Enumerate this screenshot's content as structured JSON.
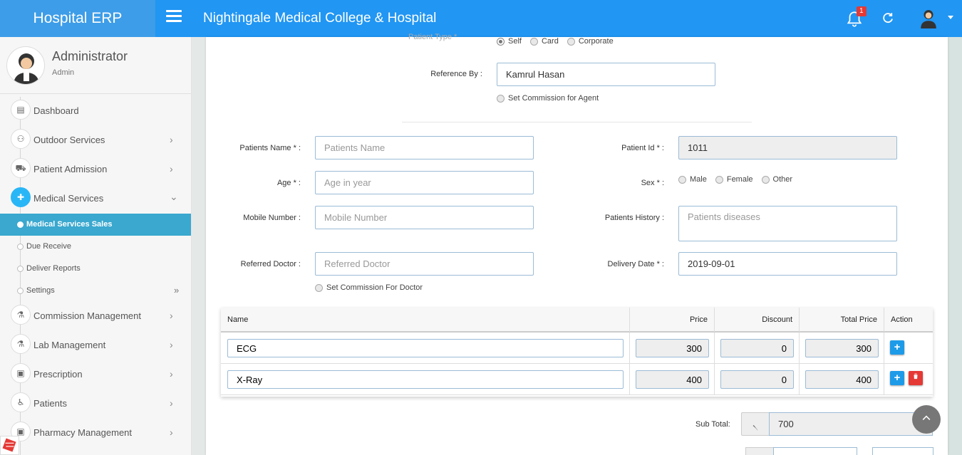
{
  "header": {
    "brand": "Hospital ERP",
    "title": "Nightingale Medical College & Hospital",
    "notification_count": "1",
    "colors": {
      "bar": "#2196f3",
      "brand_bg": "#3d9de8",
      "badge": "#e53935"
    }
  },
  "profile": {
    "name": "Administrator",
    "role": "Admin"
  },
  "sidebar": {
    "items": [
      {
        "label": "Dashboard",
        "icon": "clipboard-icon",
        "chevron": ""
      },
      {
        "label": "Outdoor Services",
        "icon": "user-group-icon",
        "chevron": "›"
      },
      {
        "label": "Patient Admission",
        "icon": "ambulance-icon",
        "chevron": "›"
      },
      {
        "label": "Medical Services",
        "icon": "medical-kit-icon",
        "chevron": "⌄"
      },
      {
        "label": "Commission Management",
        "icon": "flask-icon",
        "chevron": "›"
      },
      {
        "label": "Lab Management",
        "icon": "flask-icon",
        "chevron": "›"
      },
      {
        "label": "Prescription",
        "icon": "save-icon",
        "chevron": "›"
      },
      {
        "label": "Patients",
        "icon": "wheelchair-icon",
        "chevron": "›"
      },
      {
        "label": "Pharmacy Management",
        "icon": "save-icon",
        "chevron": "›"
      }
    ],
    "submenu": [
      {
        "label": "Medical Services Sales",
        "active": true,
        "chevron": ""
      },
      {
        "label": "Due Receive",
        "active": false,
        "chevron": ""
      },
      {
        "label": "Deliver Reports",
        "active": false,
        "chevron": ""
      },
      {
        "label": "Settings",
        "active": false,
        "chevron": "»"
      }
    ]
  },
  "form": {
    "patient_type_label": "Patient Type *",
    "patient_type_options": [
      "Self",
      "Card",
      "Corporate"
    ],
    "reference_by_label": "Reference By :",
    "reference_by_value": "Kamrul Hasan",
    "agent_commission_label": "Set Commission for Agent",
    "patients_name_label": "Patients Name * :",
    "patients_name_placeholder": "Patients Name",
    "patient_id_label": "Patient Id * :",
    "patient_id_value": "1011",
    "age_label": "Age * :",
    "age_placeholder": "Age in year",
    "sex_label": "Sex * :",
    "sex_options": [
      "Male",
      "Female",
      "Other"
    ],
    "mobile_label": "Mobile Number :",
    "mobile_placeholder": "Mobile Number",
    "history_label": "Patients History :",
    "history_placeholder": "Patients diseases",
    "referred_doctor_label": "Referred Doctor :",
    "referred_doctor_placeholder": "Referred Doctor",
    "delivery_date_label": "Delivery Date * :",
    "delivery_date_value": "2019-09-01",
    "doctor_commission_label": "Set Commission For Doctor"
  },
  "table": {
    "headers": {
      "name": "Name",
      "price": "Price",
      "discount": "Discount",
      "total": "Total Price",
      "action": "Action"
    },
    "rows": [
      {
        "name": "ECG",
        "price": "300",
        "discount": "0",
        "total": "300"
      },
      {
        "name": "X-Ray",
        "price": "400",
        "discount": "0",
        "total": "400"
      }
    ]
  },
  "summary": {
    "subtotal_label": "Sub Total:",
    "currency_symbol": "৲",
    "subtotal_value": "700"
  }
}
